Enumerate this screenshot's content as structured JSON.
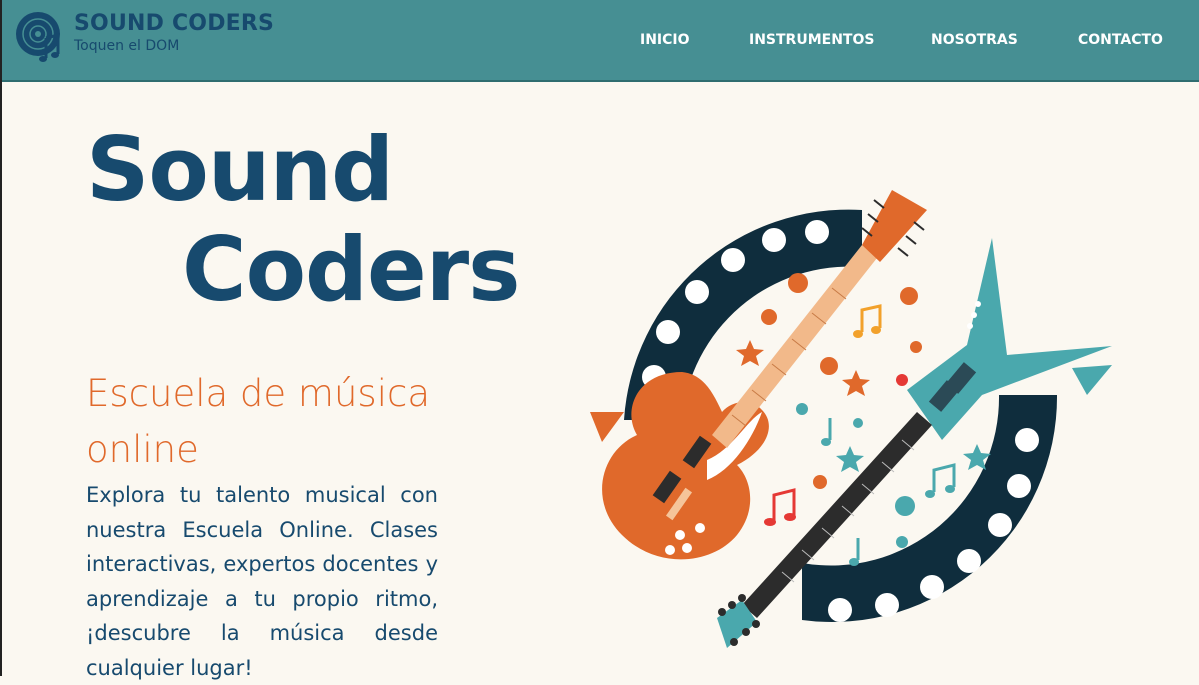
{
  "brand": {
    "title": "SOUND CODERS",
    "subtitle": "Toquen el DOM",
    "logo_icon": "vinyl-music-note-icon"
  },
  "nav": {
    "items": [
      {
        "label": "INICIO"
      },
      {
        "label": "INSTRUMENTOS"
      },
      {
        "label": "NOSOTRAS"
      },
      {
        "label": "CONTACTO"
      }
    ]
  },
  "hero": {
    "title_line1": "Sound",
    "title_line2": "Coders",
    "subtitle": "Escuela de música online",
    "description": "Explora tu talento musical con nuestra Escuela Online. Clases interactivas, expertos docentes y aprendizaje a tu propio ritmo, ¡descubre la música desde cualquier lugar!",
    "illustration_icon": "guitars-illustration-icon"
  },
  "colors": {
    "header_bg": "#468f93",
    "brand_dark": "#174a6e",
    "accent_orange": "#e0692b",
    "page_bg": "#fbf8f1",
    "teal": "#4aa8ad",
    "navy_ring": "#0f2d3d"
  }
}
